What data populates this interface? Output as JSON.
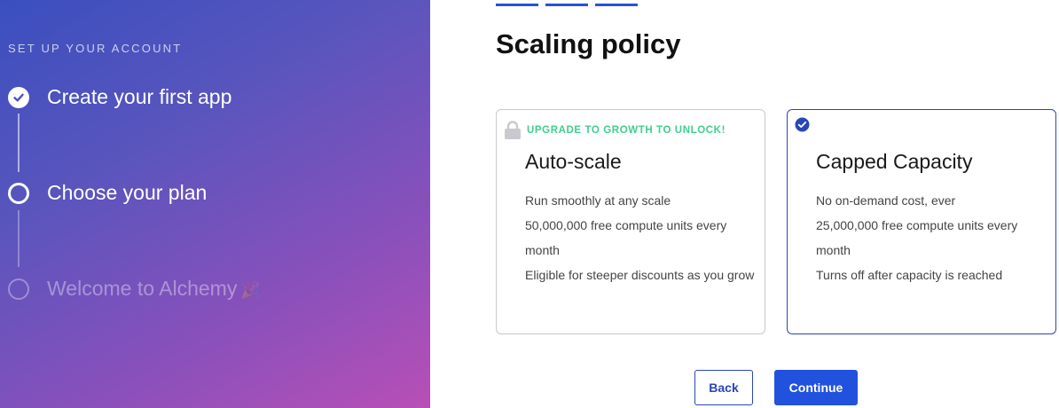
{
  "sidebar": {
    "heading": "SET UP YOUR ACCOUNT",
    "steps": [
      {
        "label": "Create your first app",
        "state": "completed"
      },
      {
        "label": "Choose your plan",
        "state": "current"
      },
      {
        "label": "Welcome to Alchemy",
        "state": "upcoming",
        "emoji": "🎉"
      }
    ]
  },
  "main": {
    "title": "Scaling policy",
    "progress_segments": 3,
    "plans": [
      {
        "name": "Auto-scale",
        "locked": true,
        "badge": "UPGRADE TO GROWTH TO UNLOCK!",
        "features": [
          "Run smoothly at any scale",
          "50,000,000 free compute units every month",
          "Eligible for steeper discounts as you grow"
        ]
      },
      {
        "name": "Capped Capacity",
        "selected": true,
        "features": [
          "No on-demand cost, ever",
          "25,000,000 free compute units every month",
          "Turns off after capacity is reached"
        ]
      }
    ],
    "buttons": {
      "back": "Back",
      "continue": "Continue"
    }
  },
  "colors": {
    "accent": "#2152de",
    "badge_green": "#3fcf8e",
    "gradient_start": "#3a4fbf",
    "gradient_end": "#b84fb6"
  },
  "icons": {
    "completed_step": "check-circle-icon",
    "current_step": "ring-icon",
    "upcoming_step": "empty-circle-icon",
    "locked": "lock-icon",
    "selected": "check-badge-icon"
  }
}
